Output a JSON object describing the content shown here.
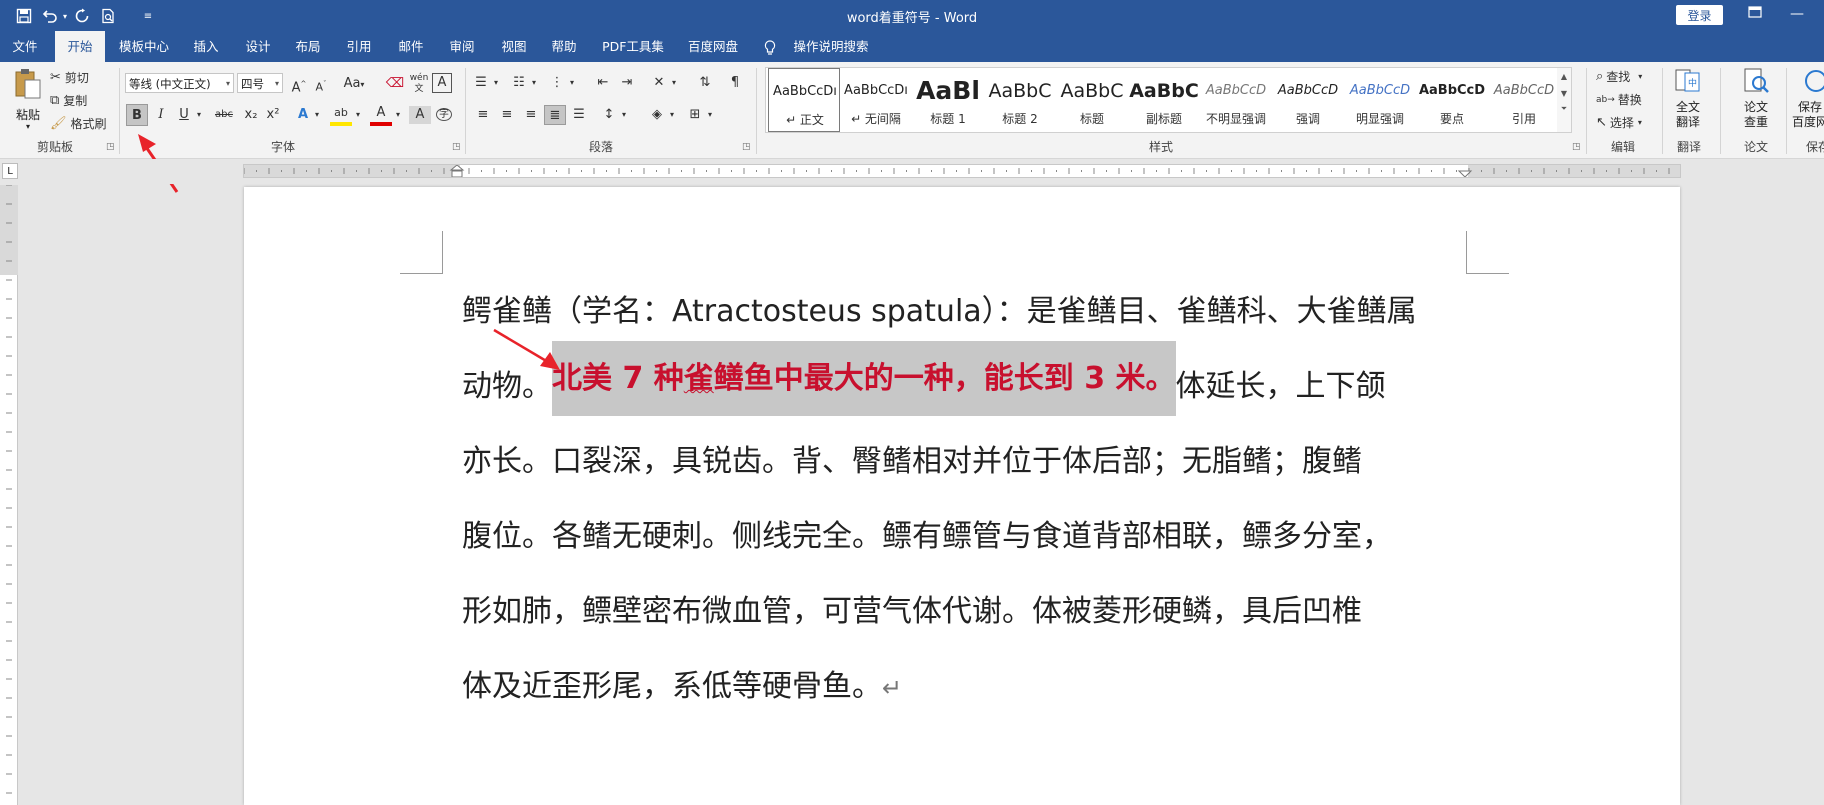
{
  "titlebar": {
    "doc_title": "word着重符号 - Word",
    "login_label": "登录",
    "quick_access": {
      "save_icon": "save-icon",
      "undo_icon": "undo-icon",
      "redo_icon": "redo-icon",
      "preview_icon": "print-preview-icon",
      "customize_icon": "customize-icon"
    }
  },
  "tabs": [
    "文件",
    "开始",
    "模板中心",
    "插入",
    "设计",
    "布局",
    "引用",
    "邮件",
    "审阅",
    "视图",
    "帮助",
    "PDF工具集",
    "百度网盘",
    "操作说明搜索"
  ],
  "active_tab": "开始",
  "clipboard": {
    "paste": "粘贴",
    "cut": "剪切",
    "copy": "复制",
    "format_painter": "格式刷",
    "group": "剪贴板"
  },
  "font": {
    "font_name": "等线 (中文正文)",
    "font_size": "四号",
    "grow": "A",
    "shrink": "A",
    "case": "Aa",
    "phonetic": "wén",
    "border": "A",
    "bold": "B",
    "italic": "I",
    "underline": "U",
    "strike": "abc",
    "sub": "x₂",
    "sup": "x²",
    "effects": "A",
    "highlight": "ab",
    "font_color": "A",
    "shade": "A",
    "enclose": "字",
    "group": "字体"
  },
  "paragraph": {
    "group": "段落"
  },
  "styles": {
    "items": [
      {
        "preview": "AaBbCcDı",
        "name": "↵ 正文"
      },
      {
        "preview": "AaBbCcDı",
        "name": "↵ 无间隔"
      },
      {
        "preview": "AaBl",
        "name": "标题 1"
      },
      {
        "preview": "AaBbC",
        "name": "标题 2"
      },
      {
        "preview": "AaBbC",
        "name": "标题"
      },
      {
        "preview": "AaBbC",
        "name": "副标题"
      },
      {
        "preview": "AaBbCcD",
        "name": "不明显强调"
      },
      {
        "preview": "AaBbCcD",
        "name": "强调"
      },
      {
        "preview": "AaBbCcD",
        "name": "明显强调"
      },
      {
        "preview": "AaBbCcD",
        "name": "要点"
      },
      {
        "preview": "AaBbCcD",
        "name": "引用"
      }
    ],
    "group": "样式"
  },
  "editing": {
    "find": "查找",
    "replace": "替换",
    "select": "选择",
    "group": "编辑"
  },
  "translate": {
    "btn_line1": "全文",
    "btn_line2": "翻译",
    "group": "翻译"
  },
  "paper": {
    "btn_line1": "论文",
    "btn_line2": "查重",
    "group": "论文"
  },
  "save_baidu": {
    "btn_line1": "保存",
    "btn_line2": "百度网",
    "group": "保存"
  },
  "document": {
    "lines": [
      "鳄雀鳝（学名：Atractosteus spatula）：是雀鳝目、雀鳝科、大雀鳝属",
      "体延长，上下颌",
      "亦长。口裂深，具锐齿。背、臀鳍相对并位于体后部；无脂鳍；腹鳍",
      "腹位。各鳍无硬刺。侧线完全。鳔有鳔管与食道背部相联，鳔多分室，",
      "形如肺，鳔壁密布微血管，可营气体代谢。体被菱形硬鳞，具后凹椎",
      "体及近歪形尾，系低等硬骨鱼。"
    ],
    "line2_prefix": "动物。",
    "highlight_a": "北美 7 种",
    "highlight_squiggle": "雀",
    "highlight_b": "鳝鱼中最大的一种，能长到 3 米。",
    "para_mark": "↵"
  },
  "colors": {
    "ribbon_blue": "#2b579a",
    "emphasis_red": "#c8102e",
    "arrow_red": "#e8232a"
  }
}
